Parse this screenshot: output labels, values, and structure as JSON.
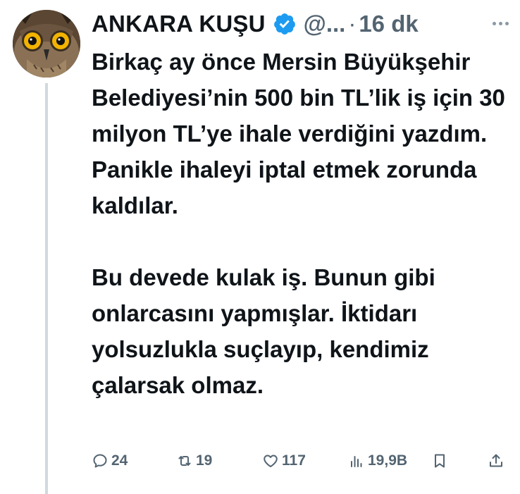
{
  "tweet": {
    "author_name": "ANKARA KUŞU",
    "handle": "@...",
    "separator": "·",
    "time": "16 dk",
    "paragraph_1": "Birkaç ay önce Mersin Büyükşehir Belediyesi’nin 500 bin TL’lik iş için 30 milyon TL’ye ihale verdiğini yazdım. Panikle ihaleyi iptal etmek zorunda kaldılar.",
    "paragraph_2": "Bu devede kulak iş. Bunun gibi onlarcasını yapmışlar. İktidarı yolsuzlukla suçlayıp, kendimiz çalarsak olmaz."
  },
  "actions": {
    "replies": "24",
    "retweets": "19",
    "likes": "117",
    "views": "19,9B"
  },
  "icons": {
    "verified": "verified-badge-icon",
    "more": "more-options-icon",
    "reply": "reply-icon",
    "retweet": "retweet-icon",
    "like": "heart-icon",
    "views": "views-chart-icon",
    "bookmark": "bookmark-icon",
    "share": "share-icon"
  },
  "colors": {
    "text": "#0f1419",
    "secondary": "#536471",
    "verified": "#1d9bf0",
    "thread_line": "#cfd9de"
  }
}
